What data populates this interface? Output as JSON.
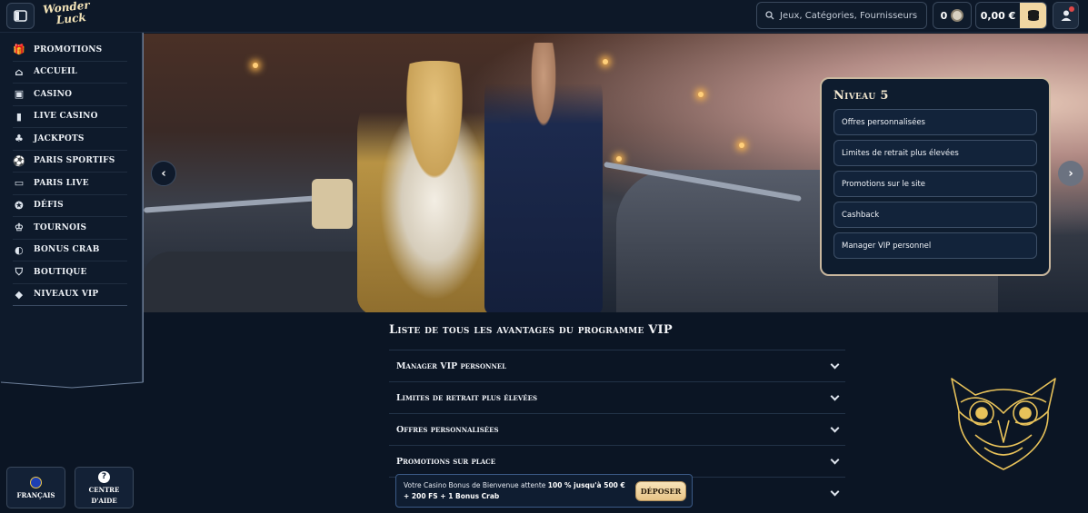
{
  "header": {
    "logo_line1": "Wonder",
    "logo_line2": "Luck",
    "search_placeholder": "Jeux, Catégories, Fournisseurs",
    "coins": "0",
    "balance": "0,00 €",
    "notification_count": "0"
  },
  "sidebar": {
    "items": [
      {
        "label": "PROMOTIONS",
        "icon": "gift-icon"
      },
      {
        "label": "ACCUEIL",
        "icon": "home-icon"
      },
      {
        "label": "CASINO",
        "icon": "slot-machine-icon"
      },
      {
        "label": "LIVE CASINO",
        "icon": "playing-card-icon"
      },
      {
        "label": "JACKPOTS",
        "icon": "clover-icon"
      },
      {
        "label": "PARIS SPORTIFS",
        "icon": "soccer-ball-icon"
      },
      {
        "label": "PARIS LIVE",
        "icon": "live-icon"
      },
      {
        "label": "DÉFIS",
        "icon": "medal-icon"
      },
      {
        "label": "TOURNOIS",
        "icon": "trophy-icon"
      },
      {
        "label": "BONUS CRAB",
        "icon": "crab-icon"
      },
      {
        "label": "BOUTIQUE",
        "icon": "shop-basket-icon"
      },
      {
        "label": "NIVEAUX VIP",
        "icon": "diamond-icon"
      }
    ],
    "language_label": "FRANÇAIS",
    "help_label_1": "CENTRE",
    "help_label_2": "D'AIDE"
  },
  "vip_card": {
    "title": "Niveau 5",
    "items": [
      "Offres personnalisées",
      "Limites de retrait plus élevées",
      "Promotions sur le site",
      "Cashback",
      "Manager VIP personnel"
    ]
  },
  "section": {
    "title": "Liste de tous les avantages du programme VIP",
    "accordion": [
      "Manager VIP personnel",
      "Limites de retrait plus élevées",
      "Offres personnalisées",
      "Promotions sur place"
    ]
  },
  "promo": {
    "text_plain": "Votre Casino Bonus de Bienvenue attente ",
    "text_bold": "100 % jusqu'à 500 € + 200 FS + 1 Bonus Crab",
    "button_label": "DÉPOSER"
  },
  "colors": {
    "background": "#0b1524",
    "accent_gold": "#f0d6a2",
    "card_border": "#c9b79e"
  }
}
